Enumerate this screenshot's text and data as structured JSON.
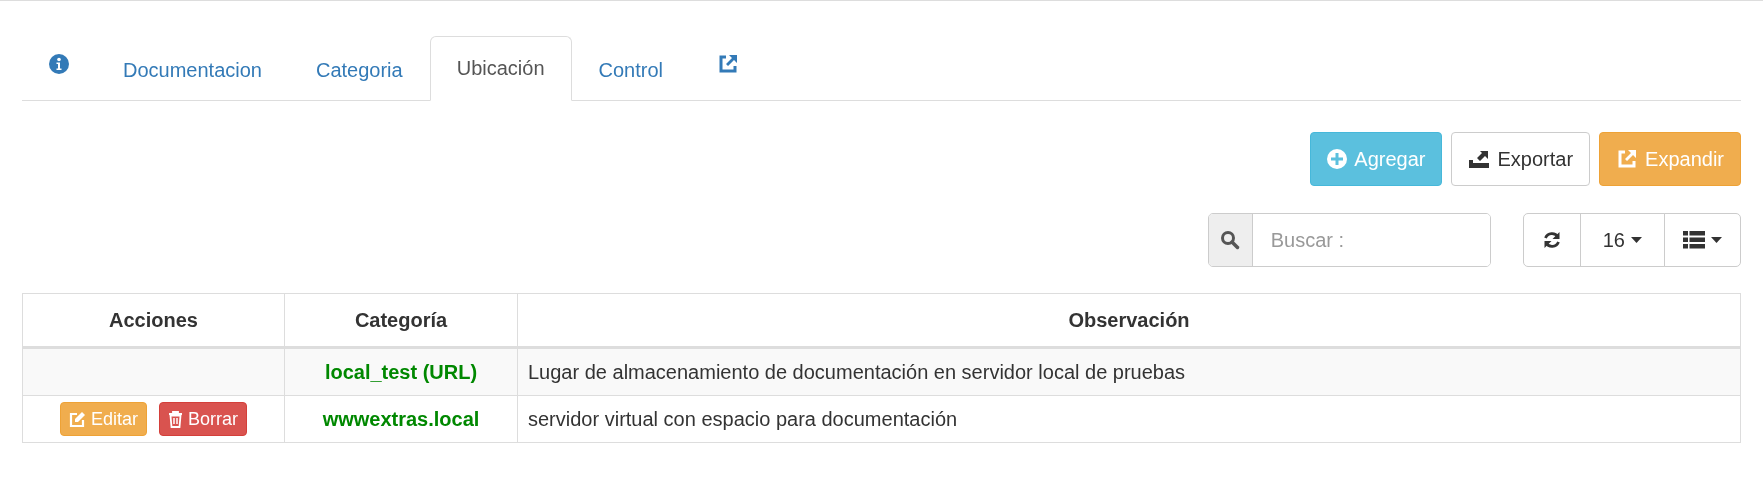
{
  "tabs": [
    {
      "kind": "info",
      "selected": false
    },
    {
      "kind": "text",
      "label": "Documentacion",
      "selected": false
    },
    {
      "kind": "text",
      "label": "Categoria",
      "selected": false
    },
    {
      "kind": "text",
      "label": "Ubicación",
      "selected": true
    },
    {
      "kind": "text",
      "label": "Control",
      "selected": false
    },
    {
      "kind": "external",
      "selected": false
    }
  ],
  "toolbar": {
    "buttons": [
      {
        "kind": "add",
        "label": "Agregar"
      },
      {
        "kind": "export",
        "label": "Exportar"
      },
      {
        "kind": "expand",
        "label": "Expandir"
      }
    ],
    "search": {
      "placeholder": "Buscar :"
    },
    "page_size": "16"
  },
  "table": {
    "columns": [
      "Acciones",
      "Categoría",
      "Observación"
    ],
    "rows": [
      {
        "actions": [],
        "category": "local_test (URL)",
        "observation": "Lugar de almacenamiento de documentación en servidor local de pruebas"
      },
      {
        "actions": [
          {
            "kind": "edit",
            "label": "Editar"
          },
          {
            "kind": "delete",
            "label": "Borrar"
          }
        ],
        "category": "wwwextras.local",
        "observation": "servidor virtual con espacio para documentación"
      }
    ]
  }
}
